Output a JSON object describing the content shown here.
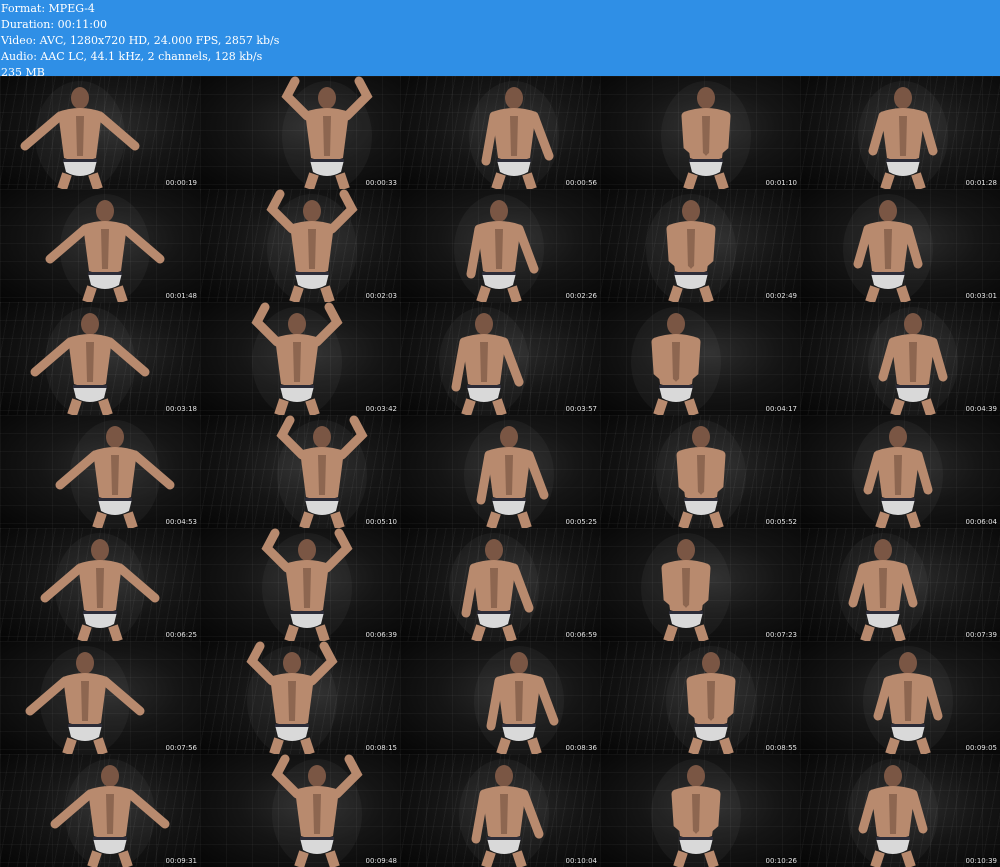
{
  "header": {
    "format": "Format: MPEG-4",
    "duration": "Duration: 00:11:00",
    "video": "Video: AVC, 1280x720 HD, 24.000 FPS, 2857 kb/s",
    "audio": "Audio: AAC LC, 44.1 kHz, 2 channels, 128 kb/s",
    "size": "235 MB"
  },
  "colors": {
    "header_bg": "#2f8fe6",
    "header_text": "#ffffff",
    "grid_bg": "#000000"
  },
  "thumbnails": [
    {
      "time": "00:00:19"
    },
    {
      "time": "00:00:33"
    },
    {
      "time": "00:00:56"
    },
    {
      "time": "00:01:10"
    },
    {
      "time": "00:01:28"
    },
    {
      "time": "00:01:48"
    },
    {
      "time": "00:02:03"
    },
    {
      "time": "00:02:26"
    },
    {
      "time": "00:02:49"
    },
    {
      "time": "00:03:01"
    },
    {
      "time": "00:03:18"
    },
    {
      "time": "00:03:42"
    },
    {
      "time": "00:03:57"
    },
    {
      "time": "00:04:17"
    },
    {
      "time": "00:04:39"
    },
    {
      "time": "00:04:53"
    },
    {
      "time": "00:05:10"
    },
    {
      "time": "00:05:25"
    },
    {
      "time": "00:05:52"
    },
    {
      "time": "00:06:04"
    },
    {
      "time": "00:06:25"
    },
    {
      "time": "00:06:39"
    },
    {
      "time": "00:06:59"
    },
    {
      "time": "00:07:23"
    },
    {
      "time": "00:07:39"
    },
    {
      "time": "00:07:56"
    },
    {
      "time": "00:08:15"
    },
    {
      "time": "00:08:36"
    },
    {
      "time": "00:08:55"
    },
    {
      "time": "00:09:05"
    },
    {
      "time": "00:09:31"
    },
    {
      "time": "00:09:48"
    },
    {
      "time": "00:10:04"
    },
    {
      "time": "00:10:26"
    },
    {
      "time": "00:10:39"
    }
  ]
}
